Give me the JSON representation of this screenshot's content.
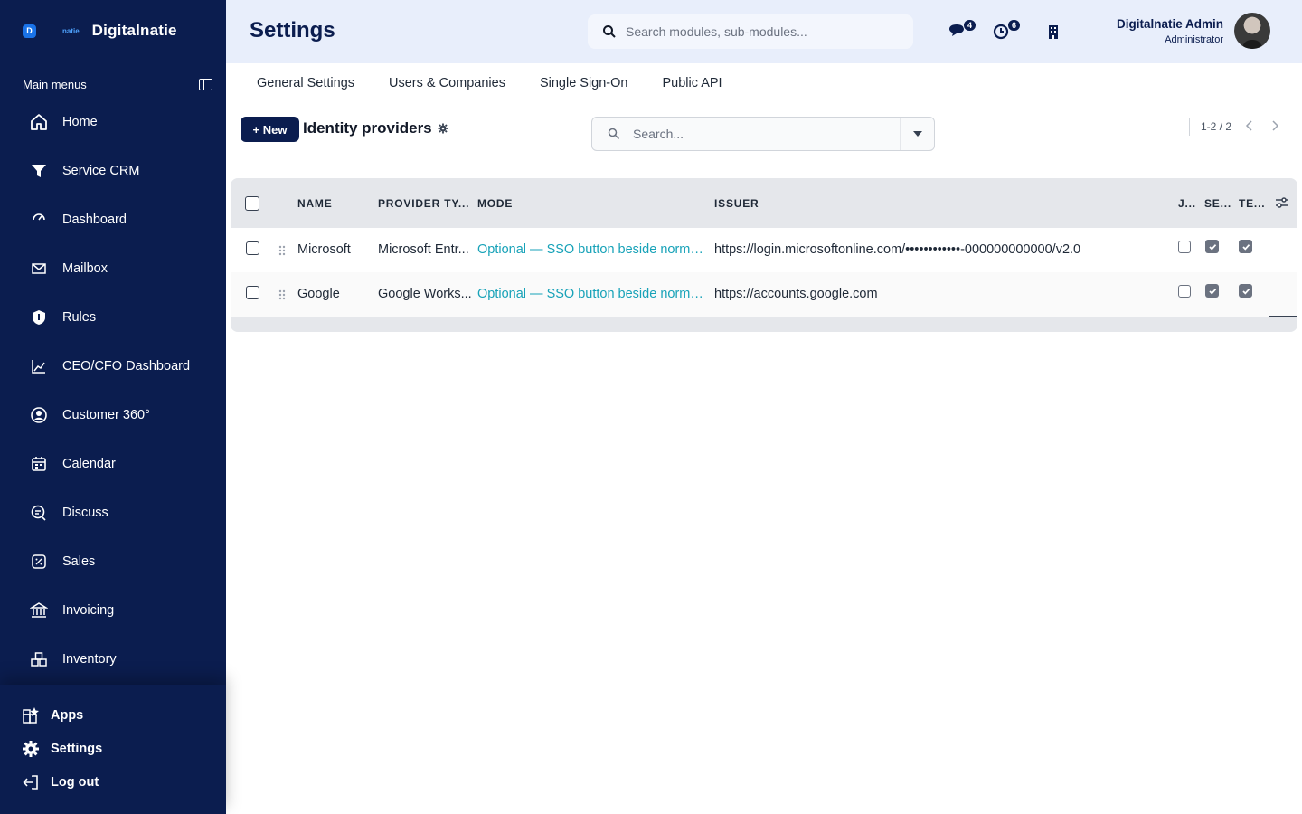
{
  "brand": {
    "badge": "D",
    "small": "natie",
    "name": "Digitalnatie"
  },
  "sidebar": {
    "section_label": "Main menus",
    "items": [
      {
        "label": "Home",
        "icon": "home-icon"
      },
      {
        "label": "Service CRM",
        "icon": "funnel-icon"
      },
      {
        "label": "Dashboard",
        "icon": "gauge-icon"
      },
      {
        "label": "Mailbox",
        "icon": "mail-icon"
      },
      {
        "label": "Rules",
        "icon": "shield-icon"
      },
      {
        "label": "CEO/CFO Dashboard",
        "icon": "line-chart-icon"
      },
      {
        "label": "Customer 360°",
        "icon": "user-circle-icon"
      },
      {
        "label": "Calendar",
        "icon": "calendar-icon"
      },
      {
        "label": "Discuss",
        "icon": "discuss-icon"
      },
      {
        "label": "Sales",
        "icon": "sales-icon"
      },
      {
        "label": "Invoicing",
        "icon": "bank-icon"
      },
      {
        "label": "Inventory",
        "icon": "inventory-icon"
      }
    ],
    "bottom": [
      {
        "label": "Apps",
        "icon": "apps-icon"
      },
      {
        "label": "Settings",
        "icon": "gear-icon"
      },
      {
        "label": "Log out",
        "icon": "logout-icon"
      }
    ]
  },
  "header": {
    "title": "Settings",
    "search_placeholder": "Search modules, sub-modules...",
    "messages_count": "4",
    "activities_count": "6",
    "user_name": "Digitalnatie Admin",
    "user_role": "Administrator"
  },
  "tabs": [
    "General Settings",
    "Users & Companies",
    "Single Sign-On",
    "Public API"
  ],
  "toolbar": {
    "new_label": "+ New",
    "list_title": "Identity providers",
    "search_placeholder": "Search...",
    "pager": "1-2 / 2"
  },
  "table": {
    "columns": [
      "NAME",
      "PROVIDER TY...",
      "MODE",
      "ISSUER",
      "J...",
      "SE...",
      "TE..."
    ],
    "rows": [
      {
        "name": "Microsoft",
        "provider_type": "Microsoft Entr...",
        "mode": "Optional — SSO button beside normal ...",
        "issuer": "https://login.microsoftonline.com/••••••••••••-000000000000/v2.0",
        "j": false,
        "se": true,
        "te": true
      },
      {
        "name": "Google",
        "provider_type": "Google Works...",
        "mode": "Optional — SSO button beside normal ...",
        "issuer": "https://accounts.google.com",
        "j": false,
        "se": true,
        "te": true
      }
    ]
  },
  "colors": {
    "sidebar_bg": "#0b1d4f",
    "header_bg": "#e8eefb",
    "accent": "#17a2b8",
    "table_header_bg": "#e5e7eb"
  }
}
